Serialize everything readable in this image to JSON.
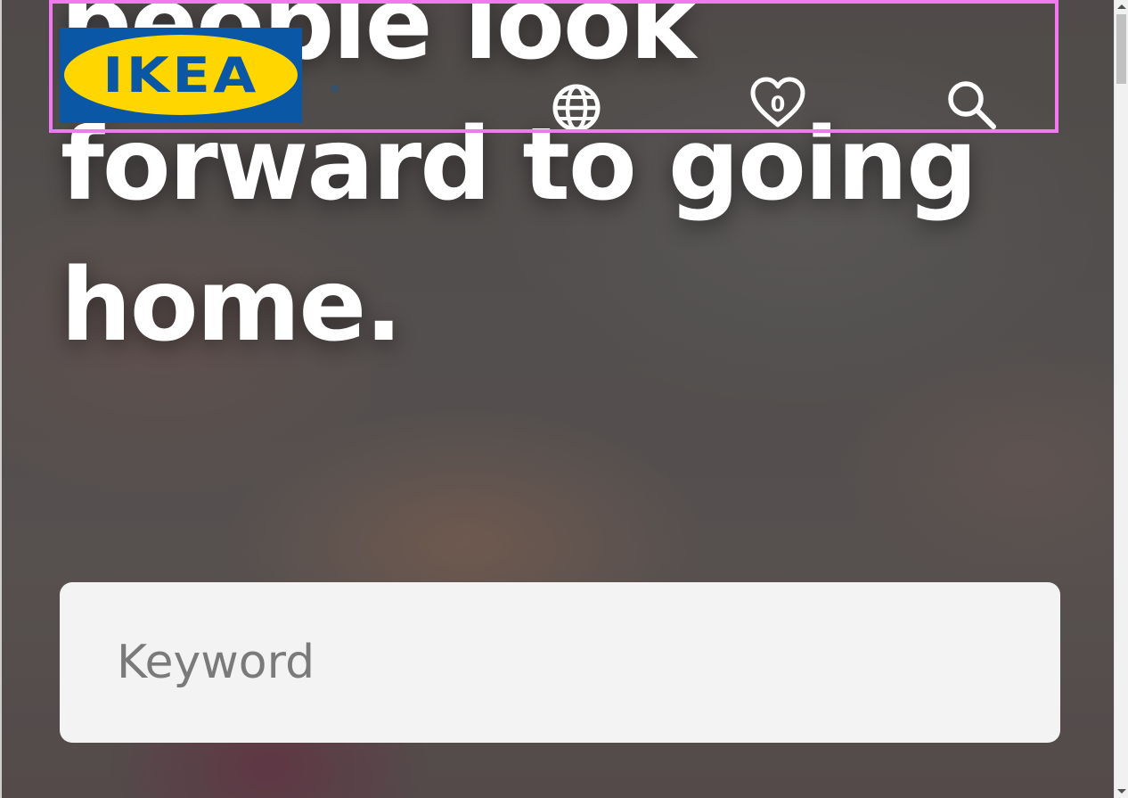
{
  "hero": {
    "headline_lines": [
      "people look",
      "forward to going",
      "home."
    ]
  },
  "header": {
    "logo_text": "IKEA",
    "logo_registered": "®",
    "icons": {
      "language": "globe-icon",
      "wishlist": "heart-icon",
      "search": "search-icon"
    },
    "wishlist_count": "0"
  },
  "search": {
    "placeholder": "Keyword",
    "value": ""
  },
  "colors": {
    "logo_blue": "#0a58a5",
    "logo_yellow": "#ffd600",
    "highlight_border": "#f27af0",
    "search_bg": "#f3f3f3"
  }
}
